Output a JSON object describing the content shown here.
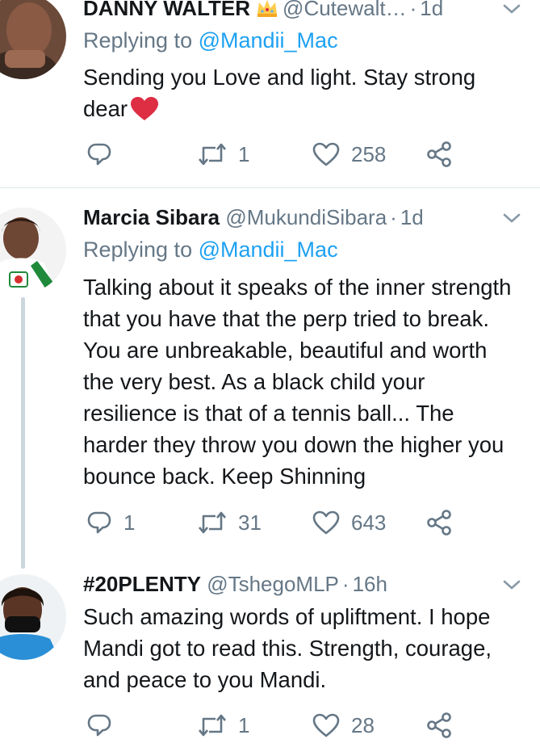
{
  "tweets": [
    {
      "name": "DANNY WALTER",
      "handle": "@Cutewalt…",
      "time": "1d",
      "replying_prefix": "Replying to ",
      "replying_to": "@Mandii_Mac",
      "text": "Sending you Love and light. Stay strong dear",
      "badge_icon": "crown-emoji",
      "text_emoji": "red-heart-emoji",
      "replies": "",
      "retweets": "1",
      "likes": "258"
    },
    {
      "name": "Marcia Sibara",
      "handle": "@MukundiSibara",
      "time": "1d",
      "replying_prefix": "Replying to ",
      "replying_to": "@Mandii_Mac",
      "text": "Talking about it speaks of the inner strength that you have that the perp tried to break. You are unbreakable, beautiful and worth the very best. As a black child your resilience is that of a tennis ball... The harder they throw you down the higher you bounce back. Keep Shinning",
      "replies": "1",
      "retweets": "31",
      "likes": "643"
    },
    {
      "name": "#20PLENTY",
      "handle": "@TshegoMLP",
      "time": "16h",
      "text": "Such amazing words of upliftment. I hope Mandi got to read this. Strength, courage, and peace to you Mandi.",
      "replies": "",
      "retweets": "1",
      "likes": "28"
    }
  ],
  "colors": {
    "text": "#14171a",
    "secondary": "#657786",
    "link": "#1da1f2",
    "divider": "#e1e8ed",
    "thread": "#ccd6dd",
    "heart": "#e0245e"
  }
}
